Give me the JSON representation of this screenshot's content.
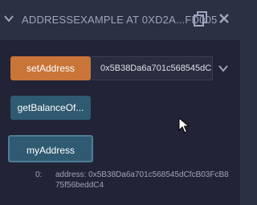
{
  "header": {
    "title": "ADDRESSEXAMPLE AT 0XD2A...FD005",
    "copy_icon": "copy-icon",
    "close_icon": "close-icon"
  },
  "functions": {
    "set_address": {
      "label": "setAddress",
      "value": "0x5B38Da6a701c568545dC"
    },
    "get_balance": {
      "label": "getBalanceOf..."
    },
    "my_address": {
      "label": "myAddress",
      "result_index": "0:",
      "result_value": "address: 0x5B38Da6a701c568545dCfcB03FcB875f56beddC4"
    }
  },
  "colors": {
    "transact_button": "#c97539",
    "call_button": "#2f5a71",
    "panel_bg": "#222336",
    "header_bg": "#2b3043"
  }
}
